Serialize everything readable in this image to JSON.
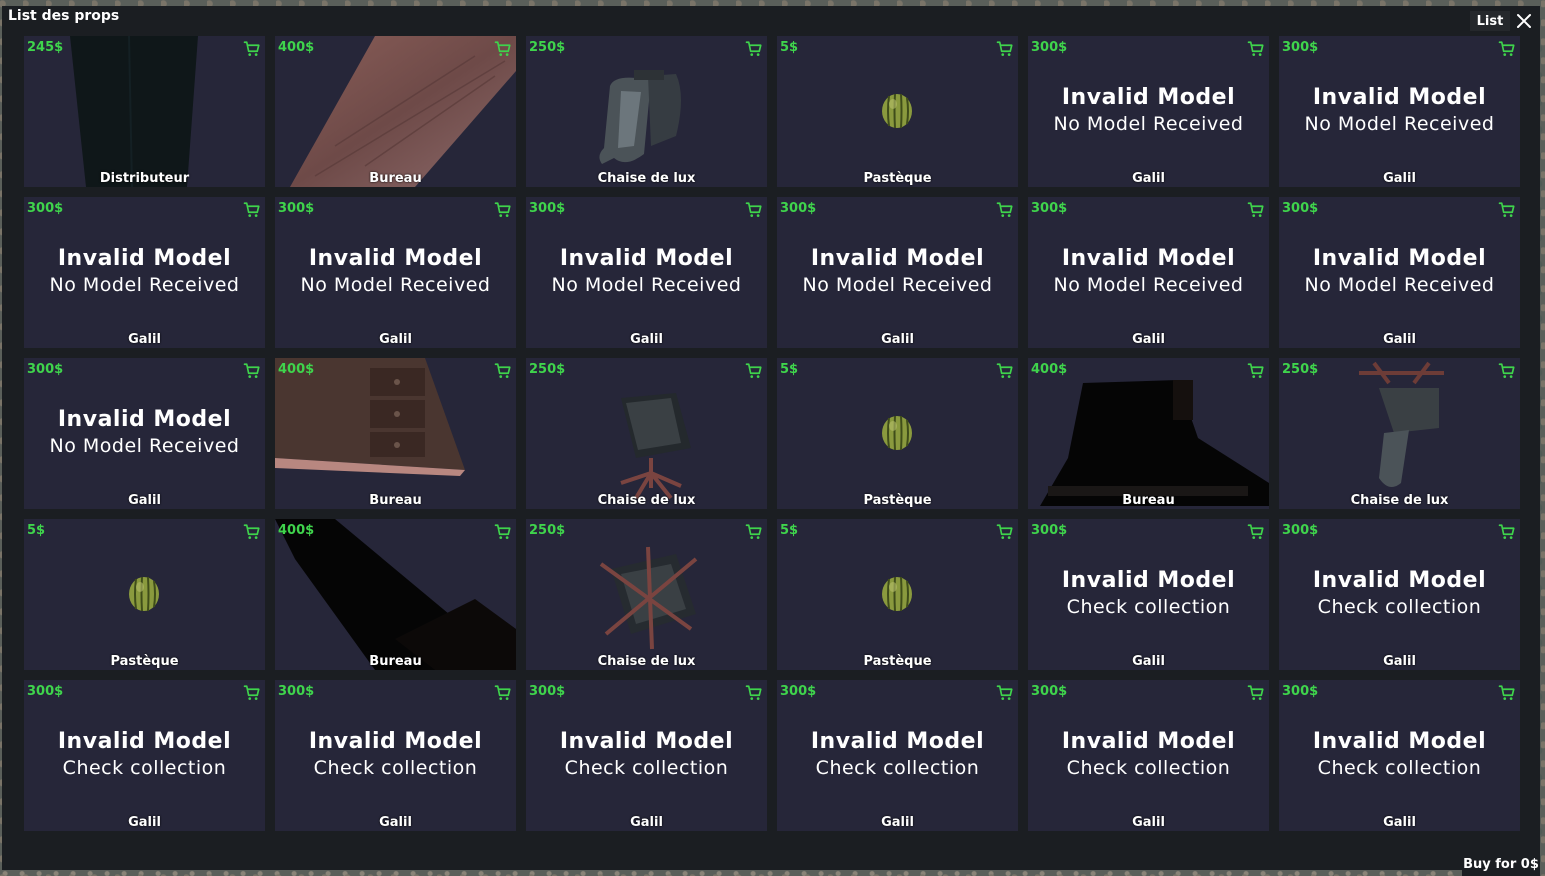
{
  "window": {
    "title": "List des props",
    "list_button": "List"
  },
  "footer": {
    "buy_label": "Buy for 0$"
  },
  "items": [
    {
      "price": "245$",
      "name": "Distributeur",
      "model": "vending"
    },
    {
      "price": "400$",
      "name": "Bureau",
      "model": "desk-plank"
    },
    {
      "price": "250$",
      "name": "Chaise de lux",
      "model": "chair-side"
    },
    {
      "price": "5$",
      "name": "Pastèque",
      "model": "melon"
    },
    {
      "price": "300$",
      "name": "Galil",
      "invalid_title": "Invalid Model",
      "invalid_reason": "No Model Received"
    },
    {
      "price": "300$",
      "name": "Galil",
      "invalid_title": "Invalid Model",
      "invalid_reason": "No Model Received"
    },
    {
      "price": "300$",
      "name": "Galil",
      "invalid_title": "Invalid Model",
      "invalid_reason": "No Model Received"
    },
    {
      "price": "300$",
      "name": "Galil",
      "invalid_title": "Invalid Model",
      "invalid_reason": "No Model Received"
    },
    {
      "price": "300$",
      "name": "Galil",
      "invalid_title": "Invalid Model",
      "invalid_reason": "No Model Received"
    },
    {
      "price": "300$",
      "name": "Galil",
      "invalid_title": "Invalid Model",
      "invalid_reason": "No Model Received"
    },
    {
      "price": "300$",
      "name": "Galil",
      "invalid_title": "Invalid Model",
      "invalid_reason": "No Model Received"
    },
    {
      "price": "300$",
      "name": "Galil",
      "invalid_title": "Invalid Model",
      "invalid_reason": "No Model Received"
    },
    {
      "price": "300$",
      "name": "Galil",
      "invalid_title": "Invalid Model",
      "invalid_reason": "No Model Received"
    },
    {
      "price": "400$",
      "name": "Bureau",
      "model": "desk-drawers"
    },
    {
      "price": "250$",
      "name": "Chaise de lux",
      "model": "chair-top"
    },
    {
      "price": "5$",
      "name": "Pastèque",
      "model": "melon"
    },
    {
      "price": "400$",
      "name": "Bureau",
      "model": "desk-dark"
    },
    {
      "price": "250$",
      "name": "Chaise de lux",
      "model": "chair-flip"
    },
    {
      "price": "5$",
      "name": "Pastèque",
      "model": "melon"
    },
    {
      "price": "400$",
      "name": "Bureau",
      "model": "desk-shadow"
    },
    {
      "price": "250$",
      "name": "Chaise de lux",
      "model": "chair-base"
    },
    {
      "price": "5$",
      "name": "Pastèque",
      "model": "melon"
    },
    {
      "price": "300$",
      "name": "Galil",
      "invalid_title": "Invalid Model",
      "invalid_reason": "Check collection"
    },
    {
      "price": "300$",
      "name": "Galil",
      "invalid_title": "Invalid Model",
      "invalid_reason": "Check collection"
    },
    {
      "price": "300$",
      "name": "Galil",
      "invalid_title": "Invalid Model",
      "invalid_reason": "Check collection"
    },
    {
      "price": "300$",
      "name": "Galil",
      "invalid_title": "Invalid Model",
      "invalid_reason": "Check collection"
    },
    {
      "price": "300$",
      "name": "Galil",
      "invalid_title": "Invalid Model",
      "invalid_reason": "Check collection"
    },
    {
      "price": "300$",
      "name": "Galil",
      "invalid_title": "Invalid Model",
      "invalid_reason": "Check collection"
    },
    {
      "price": "300$",
      "name": "Galil",
      "invalid_title": "Invalid Model",
      "invalid_reason": "Check collection"
    },
    {
      "price": "300$",
      "name": "Galil",
      "invalid_title": "Invalid Model",
      "invalid_reason": "Check collection"
    }
  ],
  "colors": {
    "price": "#3fd44c",
    "card": "#262639",
    "window": "#1b1e22"
  }
}
